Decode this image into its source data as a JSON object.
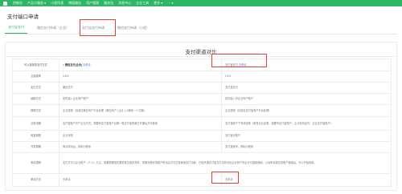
{
  "topnav": {
    "items": [
      "控制台",
      "产品与服务 ▾",
      "小程序类",
      "增值服务",
      "用户管理",
      "服务包",
      "消息中心",
      "企业工具",
      "更多 ▾",
      "··· ▾"
    ]
  },
  "page_title": "支付端口申请",
  "tabs": [
    {
      "label": "支付宝支付"
    },
    {
      "label": "微信支付申请（企业）"
    },
    {
      "label": "支付宝支付申请"
    },
    {
      "label": "微信支付申请（小程）"
    }
  ],
  "panel": {
    "title": "支付渠道对比",
    "header": {
      "label": "可以选择的支付方式",
      "col1_name": "微信支付(企业)",
      "col1_link": "去申请",
      "col2_name": "支付宝支付",
      "col2_link": "去申请"
    },
    "rows": [
      {
        "label": "交易费率",
        "col1": "0.6%",
        "col2": "0.6%"
      },
      {
        "label": "支付方式",
        "col1": "微信支付",
        "col2": "支付宝支付"
      },
      {
        "label": "适用方式",
        "col1": "暂时接入企业商户账户",
        "col2": "暂时接入的企业商户账户"
      },
      {
        "label": "提现方式",
        "col1": "企业提现（请前往微信商户平台处理（微信商户 | 企业 | 小程序一人付款）",
        "col2": "企业提现（请前往支付宝商户平台处理）"
      },
      {
        "label": "业务流程",
        "col1": "支付宝账户开户企业方式，需要有支付宝账户且第一笔支付宝收款已开通后方可使用",
        "col2": "支付宝账户下完成设置（需有企业证照，需要有支付宝账户，企业有效证件，企业支付宝账户）"
      },
      {
        "label": "资金到账",
        "col1": "企业对账",
        "col2": "支付宝对账户"
      },
      {
        "label": "开发周期",
        "col1": "申请成功后，即刻小程序",
        "col2": "支付宝账号，即刻小程序"
      },
      {
        "label": "申请说明",
        "col1": "支付方式以企业账户（个人）为主，需要根据相关要求提交相关材料，按照流程完成账户申请后方可正常使用支付功能，已经开通支付宝支付且有对应企业商户的企业可直接使用，以及申请提交到账户使用后，可以开始收款。",
        "col2": ""
      },
      {
        "label": "申请方式",
        "col1": "去申请",
        "col2": "去申请"
      }
    ]
  }
}
